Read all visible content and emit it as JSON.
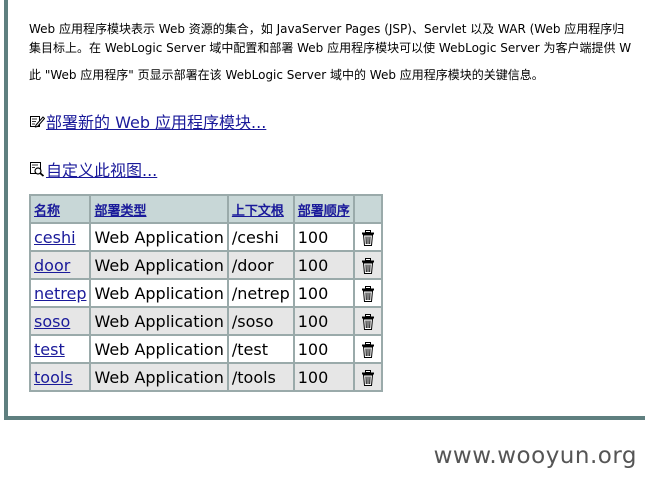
{
  "intro": {
    "line1": "Web 应用程序模块表示 Web 资源的集合，如 JavaServer Pages (JSP)、Servlet 以及 WAR (Web 应用程序归",
    "line2": "集目标上。在 WebLogic Server 域中配置和部署 Web 应用程序模块可以使 WebLogic Server 为客户端提供 W",
    "line3": "此 \"Web 应用程序\" 页显示部署在该 WebLogic Server 域中的 Web 应用程序模块的关键信息。"
  },
  "actions": {
    "deploy_label": "部署新的 Web 应用程序模块...",
    "customize_label": "自定义此视图..."
  },
  "table": {
    "headers": [
      "名称",
      "部署类型",
      "上下文根",
      "部署顺序"
    ],
    "rows": [
      {
        "name": "ceshi",
        "type": "Web Application",
        "context": "/ceshi",
        "order": "100"
      },
      {
        "name": "door",
        "type": "Web Application",
        "context": "/door",
        "order": "100"
      },
      {
        "name": "netrep",
        "type": "Web Application",
        "context": "/netrep",
        "order": "100"
      },
      {
        "name": "soso",
        "type": "Web Application",
        "context": "/soso",
        "order": "100"
      },
      {
        "name": "test",
        "type": "Web Application",
        "context": "/test",
        "order": "100"
      },
      {
        "name": "tools",
        "type": "Web Application",
        "context": "/tools",
        "order": "100"
      }
    ]
  },
  "icons": {
    "deploy": "edit-pencil-icon",
    "customize": "view-magnifier-icon",
    "delete": "trash-can-icon"
  },
  "colors": {
    "frame": "#5f7f7f",
    "header_bg": "#c8d7d7",
    "link": "#1a1a9a",
    "row_alt": "#e6e6e6"
  },
  "watermark": "www.wooyun.org"
}
